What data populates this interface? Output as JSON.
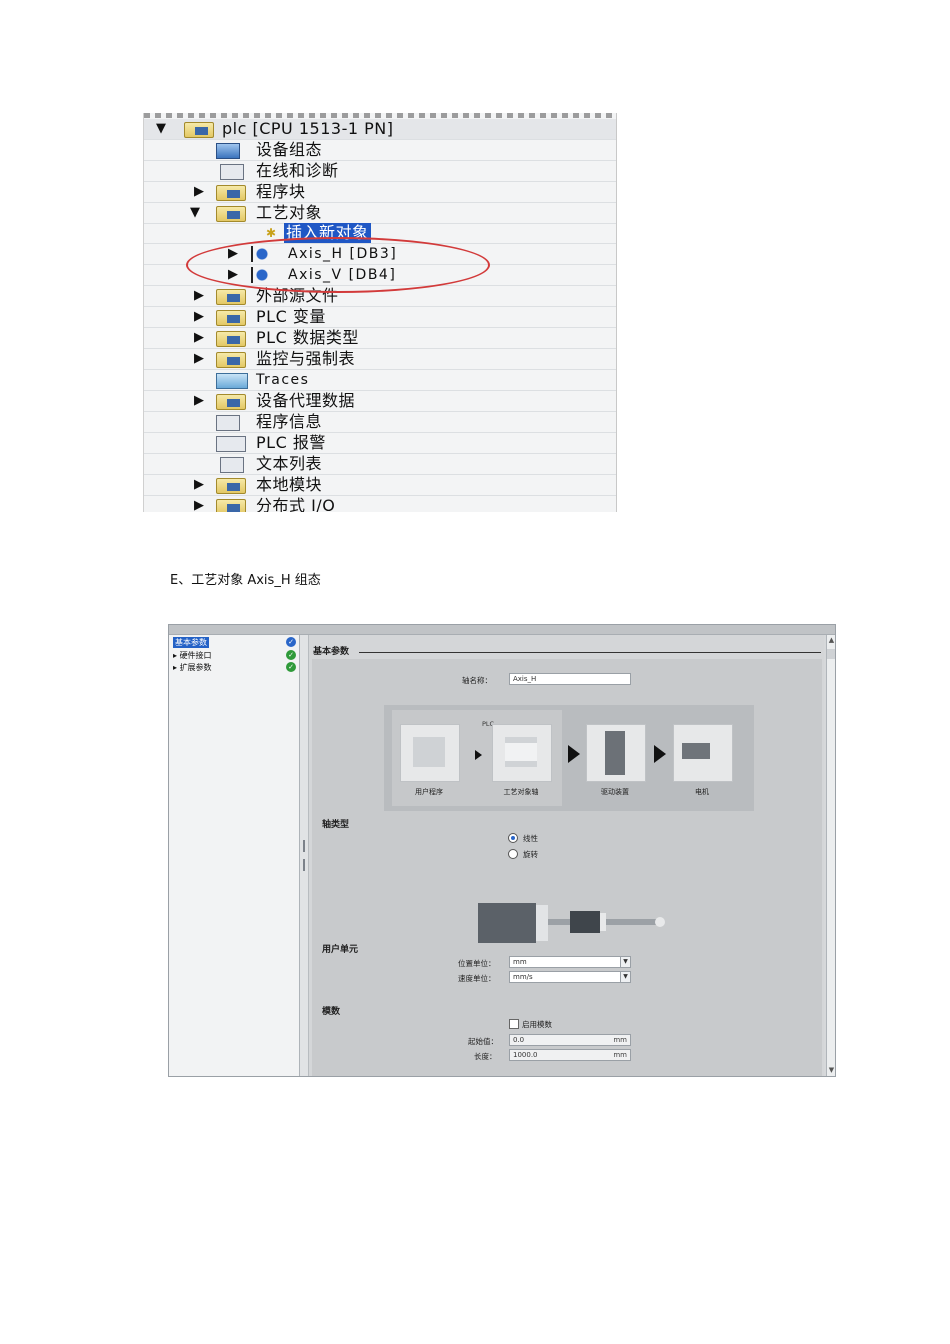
{
  "tree": {
    "root_label": "plc [CPU 1513-1 PN]",
    "items": [
      {
        "label": "设备组态"
      },
      {
        "label": "在线和诊断"
      },
      {
        "label": "程序块"
      },
      {
        "label": "工艺对象"
      },
      {
        "label": "插入新对象"
      },
      {
        "label": "Axis_H [DB3]"
      },
      {
        "label": "Axis_V [DB4]"
      },
      {
        "label": "外部源文件"
      },
      {
        "label": "PLC 变量"
      },
      {
        "label": "PLC 数据类型"
      },
      {
        "label": "监控与强制表"
      },
      {
        "label": "Traces"
      },
      {
        "label": "设备代理数据"
      },
      {
        "label": "程序信息"
      },
      {
        "label": "PLC 报警"
      },
      {
        "label": "文本列表"
      },
      {
        "label": "本地模块"
      },
      {
        "label": "分布式 I/O"
      }
    ],
    "highlight_color": "#d23a3a"
  },
  "caption": "E、工艺对象 Axis_H 组态",
  "config": {
    "nav": [
      {
        "label": "基本参数"
      },
      {
        "label": "硬件接口"
      },
      {
        "label": "扩展参数"
      }
    ],
    "basic_params": {
      "title": "基本参数",
      "axis_name_label": "轴名称：",
      "axis_name_value": "Axis_H",
      "diagram": {
        "plc_label": "PLC",
        "user_program": "用户程序",
        "tech_object": "工艺对象轴",
        "drive": "驱动装置",
        "motor": "电机"
      },
      "axis_type": {
        "title": "轴类型",
        "linear": "线性",
        "rotary": "旋转"
      },
      "user_units": {
        "title": "用户单元",
        "position_unit_label": "位置单位：",
        "position_unit_value": "mm",
        "velocity_unit_label": "速度单位：",
        "velocity_unit_value": "mm/s"
      },
      "modulo": {
        "title": "模数",
        "enable_label": "启用模数",
        "start_label": "起始值：",
        "start_value": "0.0",
        "start_unit": "mm",
        "length_label": "长度：",
        "length_value": "1000.0",
        "length_unit": "mm"
      }
    }
  }
}
